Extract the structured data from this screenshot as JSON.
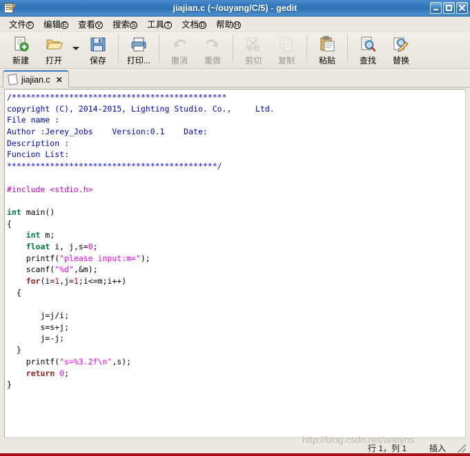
{
  "window": {
    "title": "jiajian.c (~/ouyang/C/5) - gedit",
    "icon": "gedit-notepad-pencil-icon",
    "buttons": {
      "minimize": "minimize-icon",
      "maximize": "maximize-icon",
      "close": "close-icon"
    }
  },
  "menubar": {
    "items": [
      {
        "label": "文件",
        "key": "F"
      },
      {
        "label": "编辑",
        "key": "E"
      },
      {
        "label": "查看",
        "key": "V"
      },
      {
        "label": "搜索",
        "key": "S"
      },
      {
        "label": "工具",
        "key": "T"
      },
      {
        "label": "文档",
        "key": "D"
      },
      {
        "label": "帮助",
        "key": "H"
      }
    ]
  },
  "toolbar": {
    "items": [
      {
        "label": "新建",
        "icon": "new-document-icon",
        "enabled": true
      },
      {
        "label": "打开",
        "icon": "open-folder-icon",
        "enabled": true
      },
      {
        "label": "保存",
        "icon": "save-floppy-icon",
        "enabled": true
      },
      {
        "label": "打印...",
        "icon": "print-icon",
        "enabled": true
      },
      {
        "label": "撤消",
        "icon": "undo-arrow-icon",
        "enabled": false
      },
      {
        "label": "重做",
        "icon": "redo-arrow-icon",
        "enabled": false
      },
      {
        "label": "剪切",
        "icon": "cut-scissors-icon",
        "enabled": false
      },
      {
        "label": "复制",
        "icon": "copy-icon",
        "enabled": false
      },
      {
        "label": "粘贴",
        "icon": "paste-clipboard-icon",
        "enabled": true
      },
      {
        "label": "查找",
        "icon": "find-magnifier-icon",
        "enabled": true
      },
      {
        "label": "替换",
        "icon": "replace-icon",
        "enabled": true
      }
    ]
  },
  "tabs": [
    {
      "label": "jiajian.c",
      "close": "✕",
      "active": true
    }
  ],
  "editor": {
    "lines": [
      {
        "segments": [
          {
            "t": "/*********************************************",
            "c": "c-cmt"
          }
        ]
      },
      {
        "segments": [
          {
            "t": "copyright (C), 2014-2015, Lighting Studio. Co.,     Ltd.",
            "c": "c-cmt"
          }
        ]
      },
      {
        "segments": [
          {
            "t": "File name :",
            "c": "c-cmt"
          }
        ]
      },
      {
        "segments": [
          {
            "t": "Author :Jerey_Jobs    Version:0.1    Date:",
            "c": "c-cmt"
          }
        ]
      },
      {
        "segments": [
          {
            "t": "Description :",
            "c": "c-cmt"
          }
        ]
      },
      {
        "segments": [
          {
            "t": "Funcion List:",
            "c": "c-cmt"
          }
        ]
      },
      {
        "segments": [
          {
            "t": "********************************************/",
            "c": "c-cmt"
          }
        ]
      },
      {
        "segments": [
          {
            "t": "",
            "c": "c-plain"
          }
        ]
      },
      {
        "segments": [
          {
            "t": "#include <stdio.h>",
            "c": "c-pre"
          }
        ]
      },
      {
        "segments": [
          {
            "t": "",
            "c": "c-plain"
          }
        ]
      },
      {
        "segments": [
          {
            "t": "int",
            "c": "c-kw"
          },
          {
            "t": " main()",
            "c": "c-plain"
          }
        ]
      },
      {
        "segments": [
          {
            "t": "{",
            "c": "c-plain"
          }
        ]
      },
      {
        "segments": [
          {
            "t": "    ",
            "c": "c-plain"
          },
          {
            "t": "int",
            "c": "c-kw"
          },
          {
            "t": " m;",
            "c": "c-plain"
          }
        ]
      },
      {
        "segments": [
          {
            "t": "    ",
            "c": "c-plain"
          },
          {
            "t": "float",
            "c": "c-kw"
          },
          {
            "t": " i, j,s=",
            "c": "c-plain"
          },
          {
            "t": "0",
            "c": "c-num"
          },
          {
            "t": ";",
            "c": "c-plain"
          }
        ]
      },
      {
        "segments": [
          {
            "t": "    printf(",
            "c": "c-plain"
          },
          {
            "t": "\"please input:m=\"",
            "c": "c-str"
          },
          {
            "t": ");",
            "c": "c-plain"
          }
        ]
      },
      {
        "segments": [
          {
            "t": "    scanf(",
            "c": "c-plain"
          },
          {
            "t": "\"%d\"",
            "c": "c-str"
          },
          {
            "t": ",&m);",
            "c": "c-plain"
          }
        ]
      },
      {
        "segments": [
          {
            "t": "    ",
            "c": "c-plain"
          },
          {
            "t": "for",
            "c": "c-kw2"
          },
          {
            "t": "(i=",
            "c": "c-plain"
          },
          {
            "t": "1",
            "c": "c-num2"
          },
          {
            "t": ",j=",
            "c": "c-plain"
          },
          {
            "t": "1",
            "c": "c-num2"
          },
          {
            "t": ";i<=m;i++)",
            "c": "c-plain"
          }
        ]
      },
      {
        "segments": [
          {
            "t": "  {",
            "c": "c-plain"
          }
        ]
      },
      {
        "segments": [
          {
            "t": "",
            "c": "c-plain"
          }
        ]
      },
      {
        "segments": [
          {
            "t": "       j=j/i;",
            "c": "c-plain"
          }
        ]
      },
      {
        "segments": [
          {
            "t": "       s=s+j;",
            "c": "c-plain"
          }
        ]
      },
      {
        "segments": [
          {
            "t": "       j=-j;",
            "c": "c-plain"
          }
        ]
      },
      {
        "segments": [
          {
            "t": "  }",
            "c": "c-plain"
          }
        ]
      },
      {
        "segments": [
          {
            "t": "    printf(",
            "c": "c-plain"
          },
          {
            "t": "\"s=%3.2f\\n\"",
            "c": "c-str"
          },
          {
            "t": ",s);",
            "c": "c-plain"
          }
        ]
      },
      {
        "segments": [
          {
            "t": "    ",
            "c": "c-plain"
          },
          {
            "t": "return",
            "c": "c-kw2"
          },
          {
            "t": " ",
            "c": "c-plain"
          },
          {
            "t": "0",
            "c": "c-num"
          },
          {
            "t": ";",
            "c": "c-plain"
          }
        ]
      },
      {
        "segments": [
          {
            "t": "}",
            "c": "c-plain"
          }
        ]
      }
    ]
  },
  "statusbar": {
    "position": "行 1，列 1",
    "insert_mode": "插入",
    "watermark": "http://blog.csdn.net/anoyns"
  },
  "colors": {
    "title_bar": "#2f73b8",
    "chrome": "#ece9e2",
    "comment": "#0000d0",
    "preprocessor": "#cc00cc",
    "keyword": "#007a3d",
    "control_keyword": "#9c2020",
    "string": "#f000f0",
    "editor_bg": "#ffffff"
  }
}
